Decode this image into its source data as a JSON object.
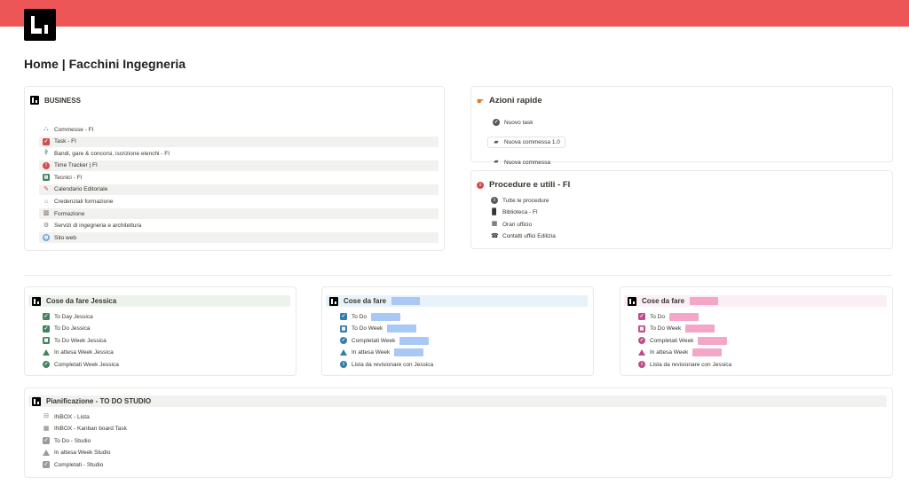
{
  "page": {
    "title": "Home | Facchini Ingegneria"
  },
  "business": {
    "title": "BUSINESS",
    "items": [
      {
        "label": "Commesse - FI",
        "icon": "sitemap-icon"
      },
      {
        "label": "Task - FI",
        "icon": "checkbox-icon"
      },
      {
        "label": "Bandi, gare & concorsi, iscrizione elenchi - FI",
        "icon": "fence-icon"
      },
      {
        "label": "Time Tracker | FI",
        "icon": "stopwatch-icon"
      },
      {
        "label": "Tecnici - FI",
        "icon": "id-card-icon"
      },
      {
        "label": "Calendario Editoriale",
        "icon": "pencil-icon"
      },
      {
        "label": "Credenziali formazione",
        "icon": "school-icon"
      },
      {
        "label": "Formazione",
        "icon": "books-icon"
      },
      {
        "label": "Servizi di ingegneria e architettura",
        "icon": "gears-icon"
      },
      {
        "label": "Sito web",
        "icon": "globe-icon"
      }
    ]
  },
  "azioni": {
    "title": "Azioni rapide",
    "buttons": [
      {
        "label": "Nuovo task",
        "icon": "check-circle-icon"
      },
      {
        "label": "Nuova commessa 1.0",
        "icon": "folder-icon"
      },
      {
        "label": "Nuova commessa",
        "icon": "folder-icon"
      }
    ]
  },
  "procedure": {
    "title": "Procedure e utili - FI",
    "items": [
      {
        "label": "Tutte le procedure",
        "icon": "info-icon"
      },
      {
        "label": "Biblioteca - FI",
        "icon": "book-icon"
      },
      {
        "label": "Orari ufficio",
        "icon": "calendar-icon"
      },
      {
        "label": "Contatti uffici Edilizia",
        "icon": "phone-icon"
      }
    ]
  },
  "jessica": {
    "title": "Cose da fare Jessica",
    "items": [
      {
        "label": "To Day Jessica"
      },
      {
        "label": "To Do Jessica"
      },
      {
        "label": "To Do Week Jessica"
      },
      {
        "label": "In attesa Week Jessica"
      },
      {
        "label": "Completati Week Jessica"
      }
    ]
  },
  "blue": {
    "title": "Cose da fare",
    "items": [
      {
        "label": "To Do"
      },
      {
        "label": "To Do Week"
      },
      {
        "label": "Completati Week"
      },
      {
        "label": "In attesa Week"
      },
      {
        "label": "Lista da revisionare con Jessica"
      }
    ]
  },
  "pink": {
    "title": "Cose da fare",
    "items": [
      {
        "label": "To Do"
      },
      {
        "label": "To Do Week"
      },
      {
        "label": "Completati Week"
      },
      {
        "label": "In attesa Week"
      },
      {
        "label": "Lista da revisionare con Jessica"
      }
    ]
  },
  "pianificazione": {
    "title": "Pianificazione - TO DO STUDIO",
    "items": [
      {
        "label": "INBOX - Lista"
      },
      {
        "label": "INBOX - Kanban board Task"
      },
      {
        "label": "To Do - Studio"
      },
      {
        "label": "In attesa Week Studio"
      },
      {
        "label": "Completati - Studio"
      }
    ]
  },
  "colors": {
    "cover": "#ec5656",
    "green": "#448361",
    "blue": "#337ea9",
    "pink": "#c14c8a",
    "blue_redact": "#a9c8f5",
    "pink_redact": "#f3a6c8"
  }
}
